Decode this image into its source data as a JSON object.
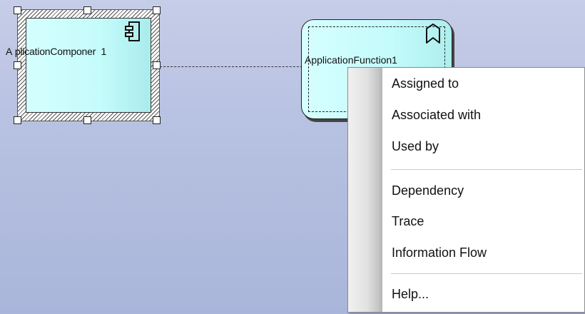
{
  "diagram": {
    "application_component": {
      "label": "A plicationComponer  1",
      "icon": "component-icon",
      "selected": true
    },
    "application_function": {
      "label": "ApplicationFunction1",
      "icon": "function-bookmark-icon"
    },
    "colors": {
      "element_fill": "#c4fbfb",
      "canvas": "#b7c1e1"
    }
  },
  "context_menu": {
    "items": [
      {
        "label": "Assigned to"
      },
      {
        "label": "Associated with"
      },
      {
        "label": "Used by"
      },
      {
        "label": "Dependency"
      },
      {
        "label": "Trace"
      },
      {
        "label": "Information Flow"
      },
      {
        "label": "Help..."
      }
    ]
  }
}
